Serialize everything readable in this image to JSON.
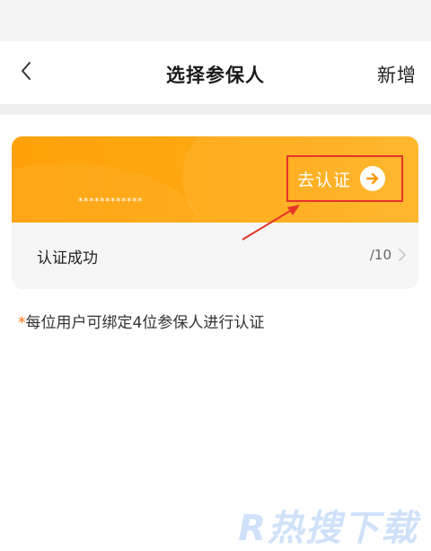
{
  "header": {
    "title": "选择参保人",
    "add_label": "新增"
  },
  "card": {
    "masked_number": "************",
    "verify_label": "去认证",
    "status_label": "认证成功",
    "count_label": "/10"
  },
  "note": {
    "star": "*",
    "text": "每位用户可绑定4位参保人进行认证"
  },
  "watermark": {
    "text": "R热搜下载"
  },
  "colors": {
    "card_orange": "#ffa20a",
    "highlight_red": "#e5342a",
    "note_star": "#ff6a00"
  },
  "icons": {
    "back": "back-arrow-icon",
    "verify": "arrow-circle-icon",
    "row_chevron": "chevron-right-icon"
  }
}
